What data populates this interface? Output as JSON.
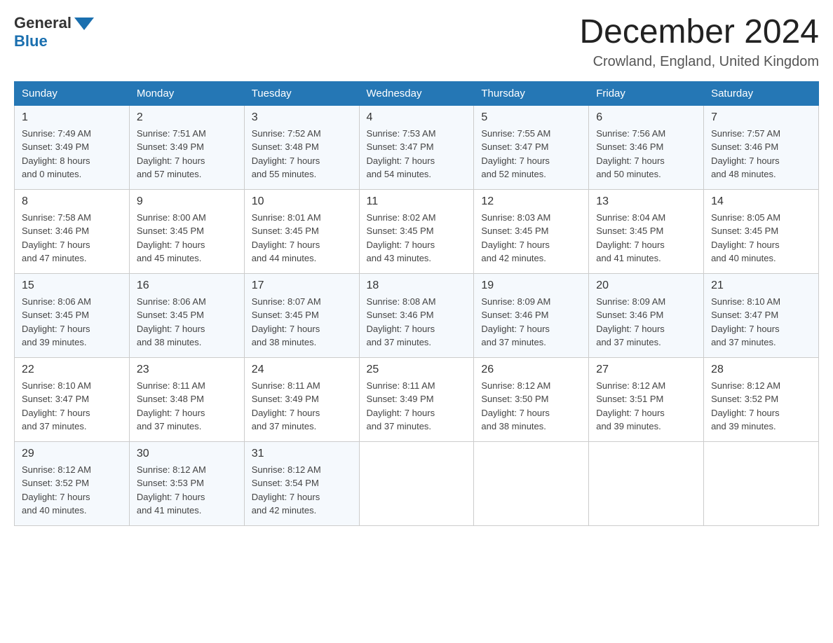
{
  "header": {
    "logo_general": "General",
    "logo_blue": "Blue",
    "month_title": "December 2024",
    "location": "Crowland, England, United Kingdom"
  },
  "days_of_week": [
    "Sunday",
    "Monday",
    "Tuesday",
    "Wednesday",
    "Thursday",
    "Friday",
    "Saturday"
  ],
  "weeks": [
    [
      {
        "day": "1",
        "sunrise": "7:49 AM",
        "sunset": "3:49 PM",
        "daylight": "8 hours and 0 minutes."
      },
      {
        "day": "2",
        "sunrise": "7:51 AM",
        "sunset": "3:49 PM",
        "daylight": "7 hours and 57 minutes."
      },
      {
        "day": "3",
        "sunrise": "7:52 AM",
        "sunset": "3:48 PM",
        "daylight": "7 hours and 55 minutes."
      },
      {
        "day": "4",
        "sunrise": "7:53 AM",
        "sunset": "3:47 PM",
        "daylight": "7 hours and 54 minutes."
      },
      {
        "day": "5",
        "sunrise": "7:55 AM",
        "sunset": "3:47 PM",
        "daylight": "7 hours and 52 minutes."
      },
      {
        "day": "6",
        "sunrise": "7:56 AM",
        "sunset": "3:46 PM",
        "daylight": "7 hours and 50 minutes."
      },
      {
        "day": "7",
        "sunrise": "7:57 AM",
        "sunset": "3:46 PM",
        "daylight": "7 hours and 48 minutes."
      }
    ],
    [
      {
        "day": "8",
        "sunrise": "7:58 AM",
        "sunset": "3:46 PM",
        "daylight": "7 hours and 47 minutes."
      },
      {
        "day": "9",
        "sunrise": "8:00 AM",
        "sunset": "3:45 PM",
        "daylight": "7 hours and 45 minutes."
      },
      {
        "day": "10",
        "sunrise": "8:01 AM",
        "sunset": "3:45 PM",
        "daylight": "7 hours and 44 minutes."
      },
      {
        "day": "11",
        "sunrise": "8:02 AM",
        "sunset": "3:45 PM",
        "daylight": "7 hours and 43 minutes."
      },
      {
        "day": "12",
        "sunrise": "8:03 AM",
        "sunset": "3:45 PM",
        "daylight": "7 hours and 42 minutes."
      },
      {
        "day": "13",
        "sunrise": "8:04 AM",
        "sunset": "3:45 PM",
        "daylight": "7 hours and 41 minutes."
      },
      {
        "day": "14",
        "sunrise": "8:05 AM",
        "sunset": "3:45 PM",
        "daylight": "7 hours and 40 minutes."
      }
    ],
    [
      {
        "day": "15",
        "sunrise": "8:06 AM",
        "sunset": "3:45 PM",
        "daylight": "7 hours and 39 minutes."
      },
      {
        "day": "16",
        "sunrise": "8:06 AM",
        "sunset": "3:45 PM",
        "daylight": "7 hours and 38 minutes."
      },
      {
        "day": "17",
        "sunrise": "8:07 AM",
        "sunset": "3:45 PM",
        "daylight": "7 hours and 38 minutes."
      },
      {
        "day": "18",
        "sunrise": "8:08 AM",
        "sunset": "3:46 PM",
        "daylight": "7 hours and 37 minutes."
      },
      {
        "day": "19",
        "sunrise": "8:09 AM",
        "sunset": "3:46 PM",
        "daylight": "7 hours and 37 minutes."
      },
      {
        "day": "20",
        "sunrise": "8:09 AM",
        "sunset": "3:46 PM",
        "daylight": "7 hours and 37 minutes."
      },
      {
        "day": "21",
        "sunrise": "8:10 AM",
        "sunset": "3:47 PM",
        "daylight": "7 hours and 37 minutes."
      }
    ],
    [
      {
        "day": "22",
        "sunrise": "8:10 AM",
        "sunset": "3:47 PM",
        "daylight": "7 hours and 37 minutes."
      },
      {
        "day": "23",
        "sunrise": "8:11 AM",
        "sunset": "3:48 PM",
        "daylight": "7 hours and 37 minutes."
      },
      {
        "day": "24",
        "sunrise": "8:11 AM",
        "sunset": "3:49 PM",
        "daylight": "7 hours and 37 minutes."
      },
      {
        "day": "25",
        "sunrise": "8:11 AM",
        "sunset": "3:49 PM",
        "daylight": "7 hours and 37 minutes."
      },
      {
        "day": "26",
        "sunrise": "8:12 AM",
        "sunset": "3:50 PM",
        "daylight": "7 hours and 38 minutes."
      },
      {
        "day": "27",
        "sunrise": "8:12 AM",
        "sunset": "3:51 PM",
        "daylight": "7 hours and 39 minutes."
      },
      {
        "day": "28",
        "sunrise": "8:12 AM",
        "sunset": "3:52 PM",
        "daylight": "7 hours and 39 minutes."
      }
    ],
    [
      {
        "day": "29",
        "sunrise": "8:12 AM",
        "sunset": "3:52 PM",
        "daylight": "7 hours and 40 minutes."
      },
      {
        "day": "30",
        "sunrise": "8:12 AM",
        "sunset": "3:53 PM",
        "daylight": "7 hours and 41 minutes."
      },
      {
        "day": "31",
        "sunrise": "8:12 AM",
        "sunset": "3:54 PM",
        "daylight": "7 hours and 42 minutes."
      },
      null,
      null,
      null,
      null
    ]
  ],
  "labels": {
    "sunrise": "Sunrise:",
    "sunset": "Sunset:",
    "daylight": "Daylight:"
  }
}
